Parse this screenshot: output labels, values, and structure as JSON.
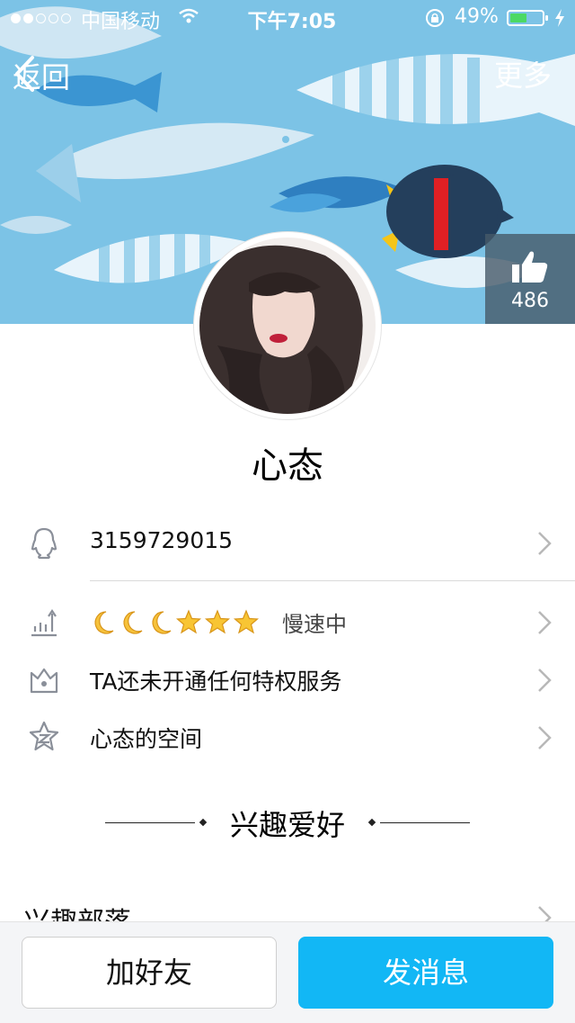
{
  "status_bar": {
    "carrier": "中国移动",
    "time": "下午7:05",
    "battery_percent": "49%",
    "battery_level": 0.49,
    "signal_bars": 2
  },
  "nav": {
    "back_label": "返回",
    "more_label": "更多"
  },
  "likes": {
    "count": "486"
  },
  "profile": {
    "name": "心态",
    "qq_number": "3159729015",
    "level": {
      "moons": 3,
      "stars": 3,
      "speed_text": "慢速中"
    },
    "privilege_text": "TA还未开通任何特权服务",
    "space_text": "心态的空间"
  },
  "interests": {
    "section_title": "兴趣爱好",
    "first_item": "兴趣部落"
  },
  "actions": {
    "add_friend": "加好友",
    "send_message": "发消息"
  },
  "colors": {
    "header_bg": "#7cc3e6",
    "primary": "#12b7f5",
    "battery_fill": "#4cd964"
  },
  "icons": [
    "signal-icon",
    "wifi-icon",
    "rotation-lock-icon",
    "battery-icon",
    "charging-bolt-icon",
    "back-chevron-icon",
    "thumbs-up-icon",
    "qq-penguin-icon",
    "level-bars-icon",
    "crown-icon",
    "qzone-star-icon",
    "moon-icon",
    "star-icon",
    "chevron-right-icon"
  ]
}
